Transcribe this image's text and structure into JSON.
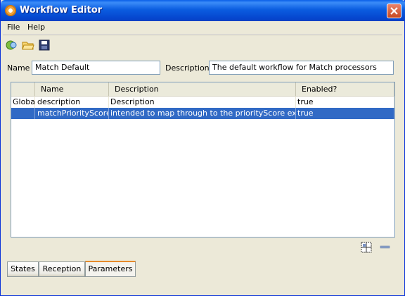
{
  "window": {
    "title": "Workflow Editor"
  },
  "menu": {
    "items": [
      "File",
      "Help"
    ]
  },
  "toolbar": {
    "icons": [
      "new-icon",
      "open-folder-icon",
      "save-icon"
    ]
  },
  "form": {
    "name_label": "Name",
    "name_value": "Match Default",
    "description_label": "Description",
    "description_value": "The default workflow for Match processors"
  },
  "table": {
    "columns": [
      "",
      "Name",
      "Description",
      "Enabled?"
    ],
    "rows": [
      {
        "scope": "Global",
        "name": "description",
        "description": "Description",
        "enabled": "true",
        "selected": false
      },
      {
        "scope": "",
        "name": "matchPriorityScore",
        "description": "intended to map through to the priorityScore exten…",
        "enabled": "true",
        "selected": true
      }
    ]
  },
  "actions": {
    "icons": [
      "add-row-grid-icon",
      "remove-minus-icon"
    ]
  },
  "tabs": {
    "items": [
      "States",
      "Reception",
      "Parameters"
    ],
    "active": "Parameters"
  },
  "colors": {
    "title_bar": "#0a5fe8",
    "selection": "#316ac5",
    "window_bg": "#ece9d8",
    "active_tab_accent": "#e68b2c"
  }
}
